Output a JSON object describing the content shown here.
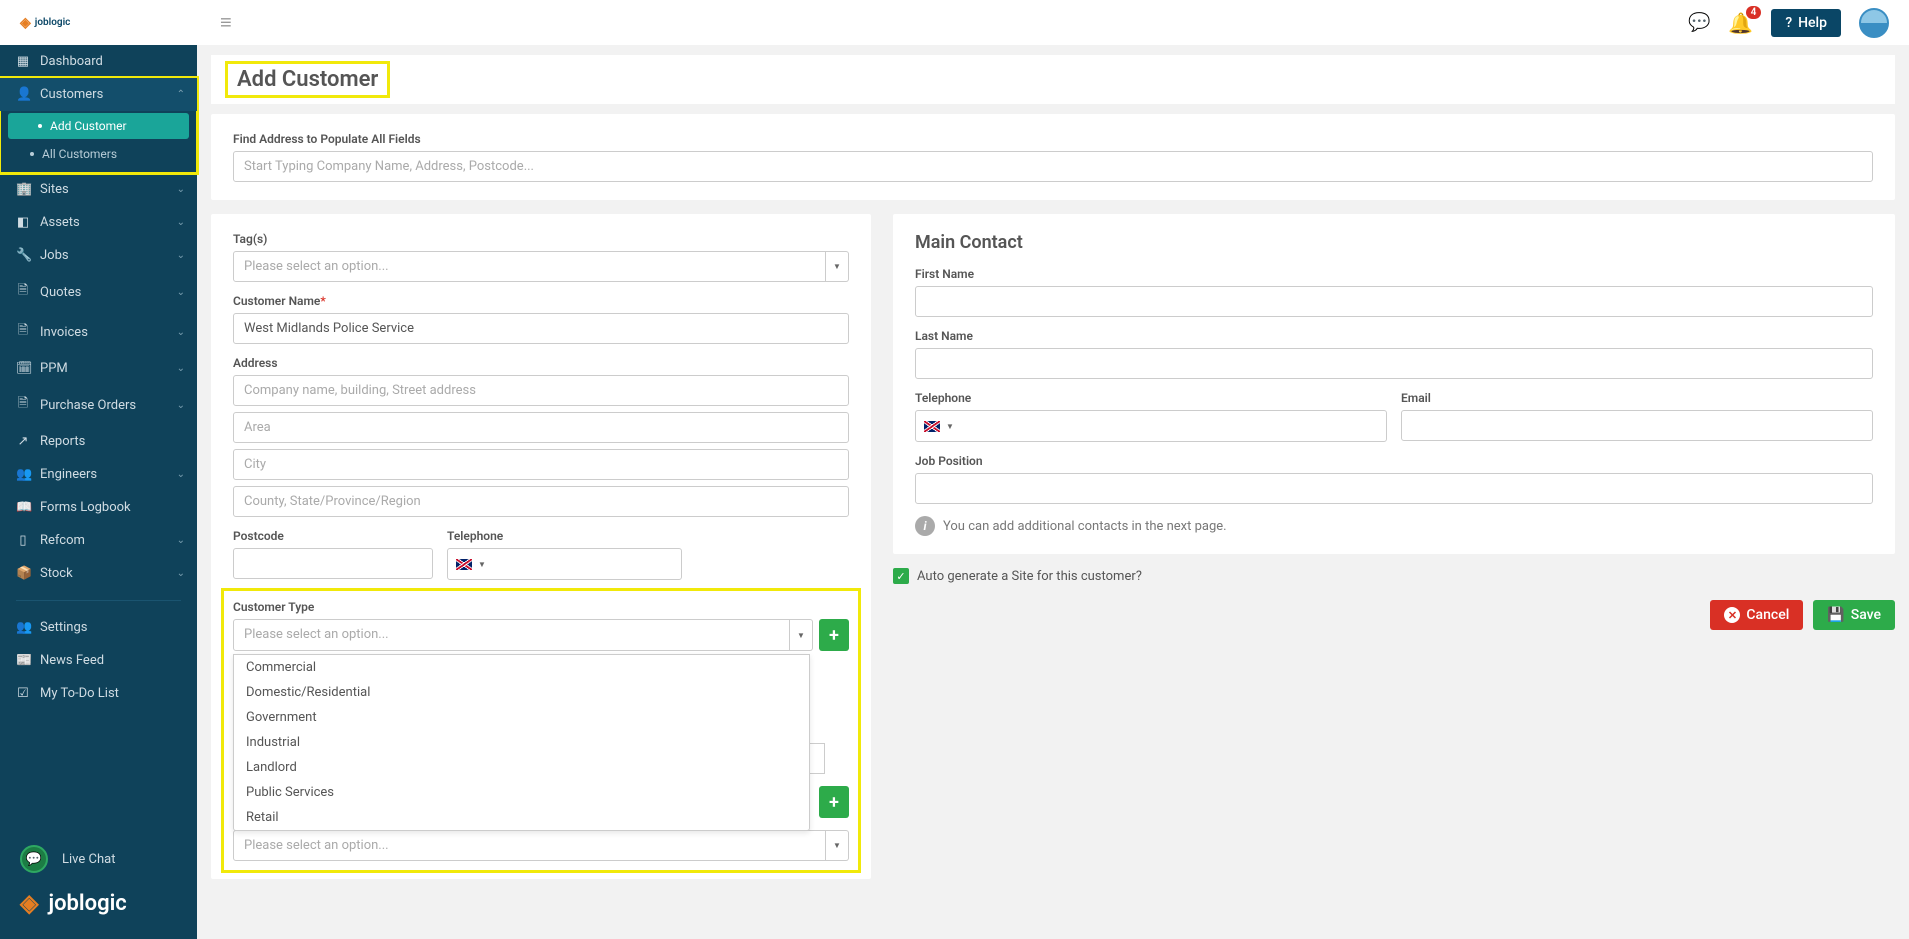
{
  "topbar": {
    "logo": "joblogic",
    "help": "Help",
    "notifications": "4"
  },
  "sidebar": {
    "items": [
      {
        "label": "Dashboard",
        "icon": "▦"
      },
      {
        "label": "Customers",
        "icon": "👤",
        "expanded": true,
        "children": [
          {
            "label": "Add Customer",
            "active": true
          },
          {
            "label": "All Customers"
          }
        ]
      },
      {
        "label": "Sites",
        "icon": "🏢"
      },
      {
        "label": "Assets",
        "icon": "◧"
      },
      {
        "label": "Jobs",
        "icon": "🔧"
      },
      {
        "label": "Quotes",
        "icon": "🗎"
      },
      {
        "label": "Invoices",
        "icon": "🗎"
      },
      {
        "label": "PPM",
        "icon": "🗓"
      },
      {
        "label": "Purchase Orders",
        "icon": "🗎"
      },
      {
        "label": "Reports",
        "icon": "↗"
      },
      {
        "label": "Engineers",
        "icon": "👥"
      },
      {
        "label": "Forms Logbook",
        "icon": "📖"
      },
      {
        "label": "Refcom",
        "icon": "▯"
      },
      {
        "label": "Stock",
        "icon": "📦"
      }
    ],
    "bottom": [
      {
        "label": "Settings",
        "icon": "👥"
      },
      {
        "label": "News Feed",
        "icon": "📰"
      },
      {
        "label": "My To-Do List",
        "icon": "☑"
      }
    ],
    "livechat": "Live Chat",
    "brand": "joblogic"
  },
  "page": {
    "title": "Add Customer"
  },
  "addr": {
    "label": "Find Address to Populate All Fields",
    "placeholder": "Start Typing Company Name, Address, Postcode..."
  },
  "form": {
    "tags": {
      "label": "Tag(s)",
      "placeholder": "Please select an option..."
    },
    "name": {
      "label": "Customer Name",
      "value": "West Midlands Police Service"
    },
    "address": {
      "label": "Address",
      "p1": "Company name, building, Street address",
      "p2": "Area",
      "p3": "City",
      "p4": "County, State/Province/Region"
    },
    "postcode": {
      "label": "Postcode"
    },
    "telephone": {
      "label": "Telephone"
    },
    "ctype": {
      "label": "Customer Type",
      "placeholder": "Please select an option...",
      "options": [
        "Commercial",
        "Domestic/Residential",
        "Government",
        "Industrial",
        "Landlord",
        "Public Services",
        "Retail"
      ]
    },
    "selectplaceholder": "Please select an option..."
  },
  "contact": {
    "title": "Main Contact",
    "first": "First Name",
    "last": "Last Name",
    "tel": "Telephone",
    "email": "Email",
    "pos": "Job Position",
    "info": "You can add additional contacts in the next page."
  },
  "auto": {
    "label": "Auto generate a Site for this customer?"
  },
  "buttons": {
    "cancel": "Cancel",
    "save": "Save"
  }
}
